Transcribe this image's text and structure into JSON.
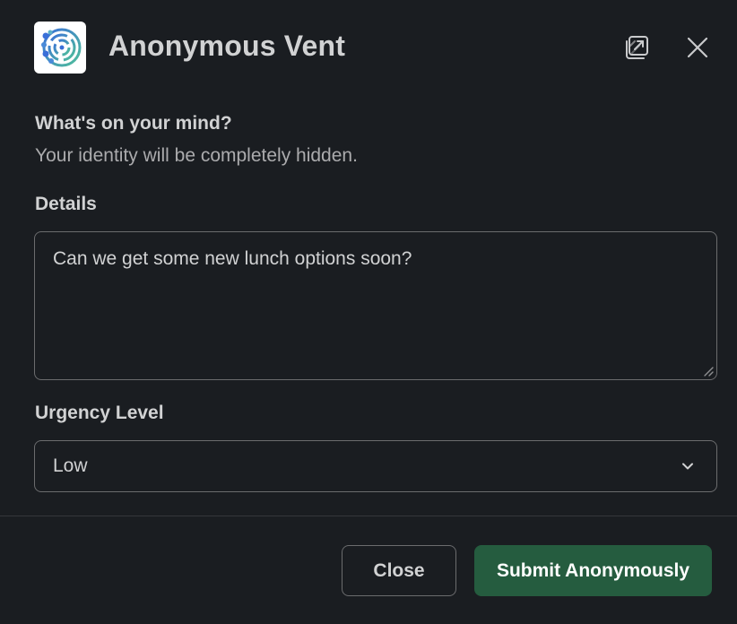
{
  "header": {
    "title": "Anonymous Vent",
    "logo_icon": "anonymous-vent-app-logo",
    "popout_icon": "popout-window-icon",
    "close_icon": "close-icon"
  },
  "form": {
    "question": "What's on your mind?",
    "subtext": "Your identity will be completely hidden.",
    "details": {
      "label": "Details",
      "value": "Can we get some new lunch options soon?"
    },
    "urgency": {
      "label": "Urgency Level",
      "selected": "Low"
    }
  },
  "footer": {
    "close_label": "Close",
    "submit_label": "Submit Anonymously"
  },
  "colors": {
    "background": "#1a1d21",
    "submit_button": "#255c3f",
    "border": "#6b6c6e"
  }
}
